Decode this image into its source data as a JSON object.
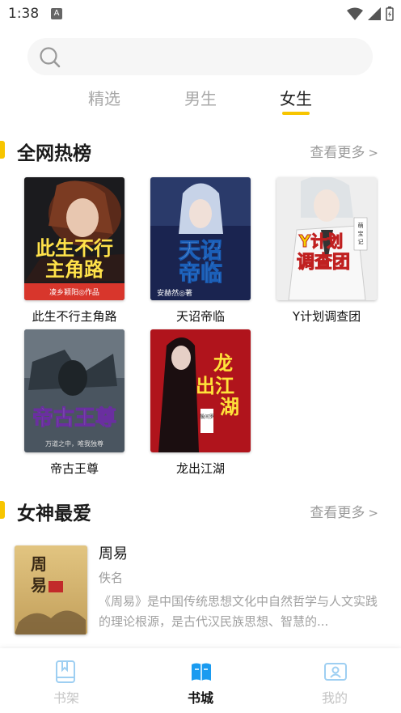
{
  "status_bar": {
    "time": "1:38",
    "notification_badge": "A"
  },
  "search": {
    "placeholder": ""
  },
  "tabs": [
    {
      "label": "精选",
      "active": false
    },
    {
      "label": "男生",
      "active": false
    },
    {
      "label": "女生",
      "active": true
    }
  ],
  "sections": {
    "hot": {
      "title": "全网热榜",
      "more": "查看更多"
    },
    "favorite": {
      "title": "女神最爱",
      "more": "查看更多"
    }
  },
  "hot_books": [
    {
      "title": "此生不行主角路",
      "cover_text": "此生不行主角路",
      "cover_author": "凌乡颖阳◎作品"
    },
    {
      "title": "天诏帝临",
      "cover_text": "天诏帝临",
      "cover_author": "安赫然◎著"
    },
    {
      "title": "Y计划调查团",
      "cover_text": "Y计划调查团",
      "cover_author": "萌宝记"
    },
    {
      "title": "帝古王尊",
      "cover_text": "帝古王尊",
      "cover_author": "万道之中，唯我独尊"
    },
    {
      "title": "龙出江湖",
      "cover_text": "龙出江湖",
      "cover_author": "一殷间罗◎著"
    }
  ],
  "favorite_list": [
    {
      "title": "周易",
      "author": "佚名",
      "description": "《周易》是中国传统思想文化中自然哲学与人文实践的理论根源，是古代汉民族思想、智慧的...",
      "cover_text": "周易"
    }
  ],
  "bottom_nav": [
    {
      "label": "书架",
      "icon": "bookshelf-icon",
      "active": false
    },
    {
      "label": "书城",
      "icon": "bookstore-icon",
      "active": true
    },
    {
      "label": "我的",
      "icon": "profile-icon",
      "active": false
    }
  ],
  "colors": {
    "accent": "#f7c500",
    "active_nav": "#1a9bf0",
    "inactive_nav": "#9ecff2"
  }
}
